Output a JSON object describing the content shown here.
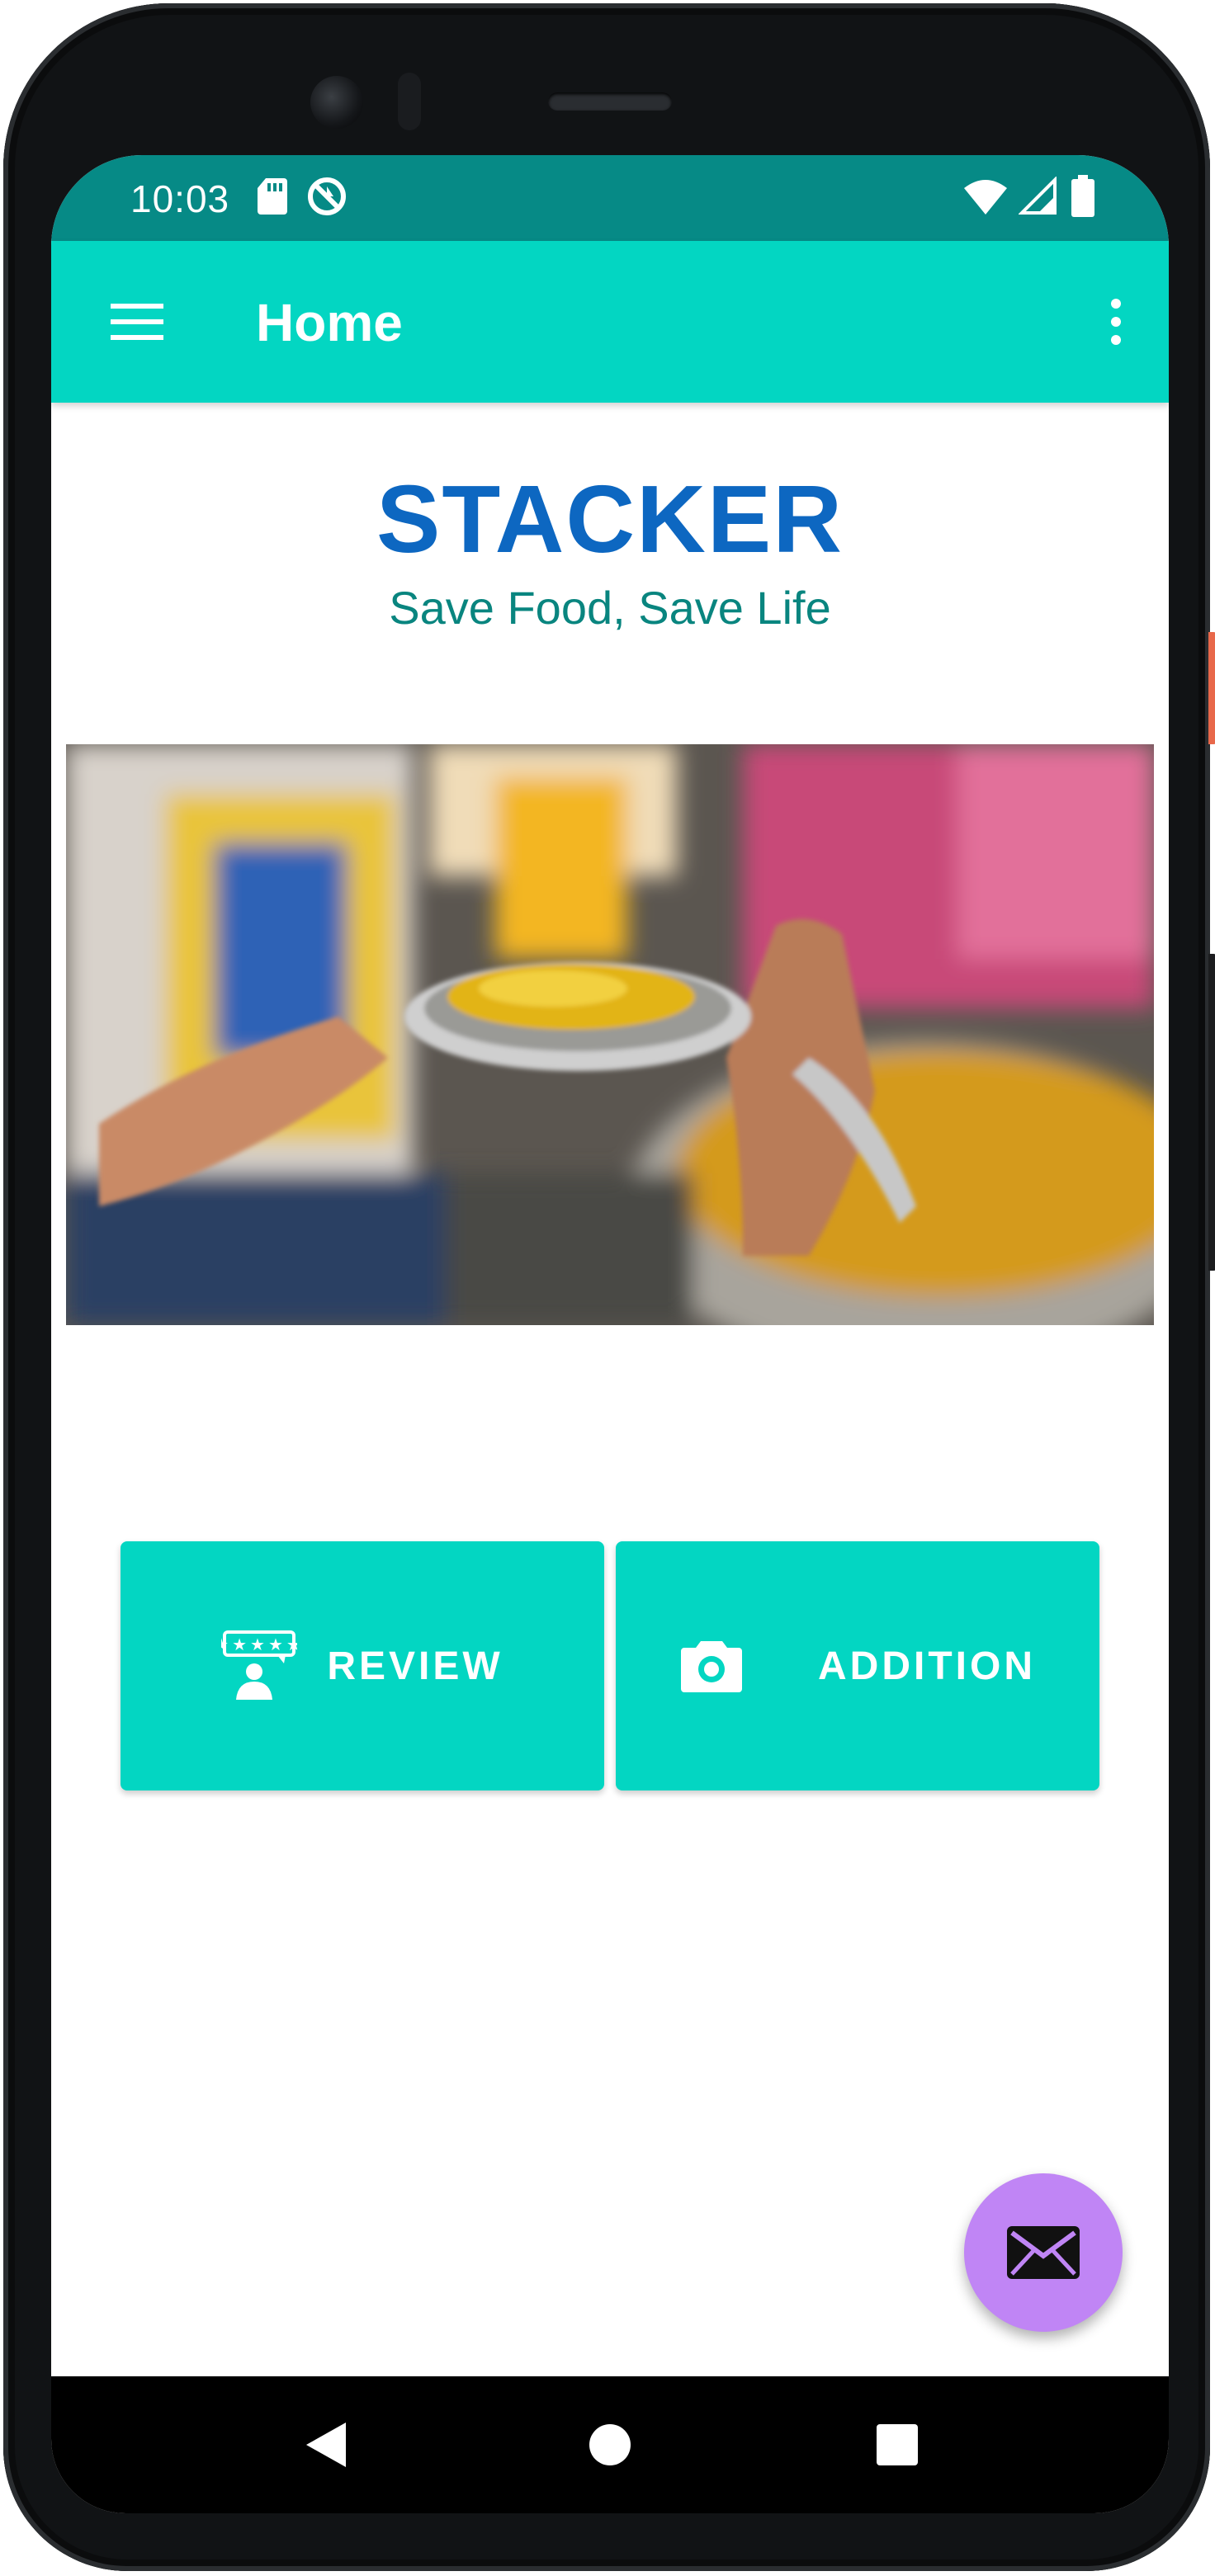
{
  "status_bar": {
    "time": "10:03",
    "icons": [
      "sd-card-icon",
      "sync-disabled-icon",
      "wifi-icon",
      "cellular-signal-icon",
      "battery-icon"
    ]
  },
  "app_bar": {
    "title": "Home",
    "menu_icon": "hamburger-menu-icon",
    "overflow_icon": "more-vertical-icon"
  },
  "brand": {
    "name": "STACKER",
    "tagline": "Save Food, Save Life"
  },
  "hero": {
    "icon": "food-sharing-photo"
  },
  "actions": {
    "review": {
      "label": "REVIEW",
      "icon": "rating-review-icon"
    },
    "addition": {
      "label": "ADDITION",
      "icon": "camera-icon"
    }
  },
  "fab": {
    "icon": "mail-icon"
  },
  "nav": {
    "icons": [
      "back-triangle-icon",
      "home-circle-icon",
      "recents-square-icon"
    ]
  },
  "colors": {
    "status_bar": "#068a86",
    "app_bar": "#03d6c2",
    "brand_title": "#0d67c1",
    "tagline": "#09857f",
    "fab": "#c085f5"
  }
}
